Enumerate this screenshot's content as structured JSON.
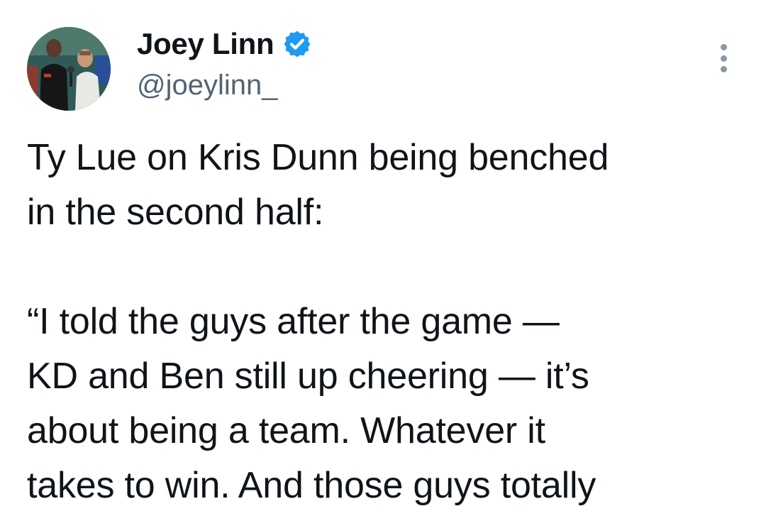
{
  "tweet": {
    "author": {
      "display_name": "Joey Linn",
      "handle": "@joeylinn_",
      "verified": true,
      "avatar_icon": "profile-photo"
    },
    "more_icon": "vertical-ellipsis-icon",
    "text_lines": [
      "Ty Lue on Kris Dunn being benched",
      "in the second half:",
      "",
      "“I told the guys after the game —",
      "KD and Ben still up cheering — it’s",
      "about being a team. Whatever it",
      "takes to win. And those guys totally"
    ]
  },
  "colors": {
    "text": "#0f1419",
    "secondary": "#536471",
    "verified_blue": "#1d9bf0",
    "background": "#ffffff"
  }
}
